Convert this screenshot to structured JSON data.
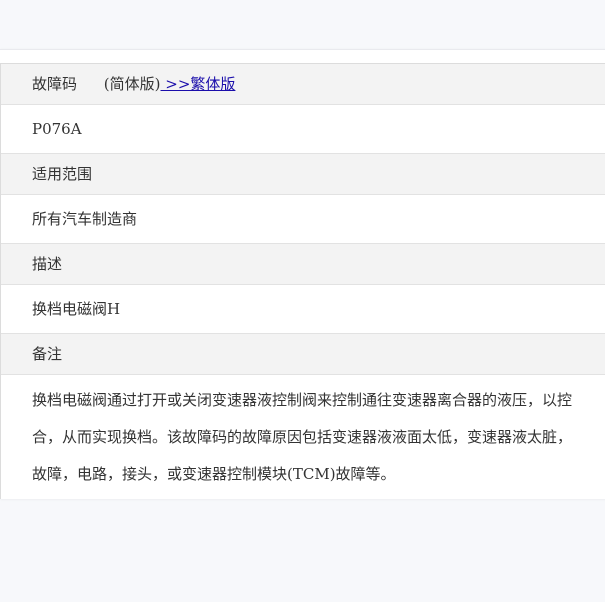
{
  "fault_code_section": {
    "label": "故障码",
    "version_simplified": "(简体版)",
    "version_traditional_link": " >>繁体版",
    "value": "P076A"
  },
  "scope_section": {
    "label": "适用范围",
    "value": "所有汽车制造商"
  },
  "description_section": {
    "label": "描述",
    "value": "换档电磁阀H"
  },
  "notes_section": {
    "label": "备注",
    "lines": [
      "换档电磁阀通过打开或关闭变速器液控制阀来控制通往变速器离合器的液压，以控",
      "合，从而实现换档。该故障码的故障原因包括变速器液液面太低，变速器液太脏，",
      "故障，电路，接头，或变速器控制模块(TCM)故障等。"
    ]
  }
}
